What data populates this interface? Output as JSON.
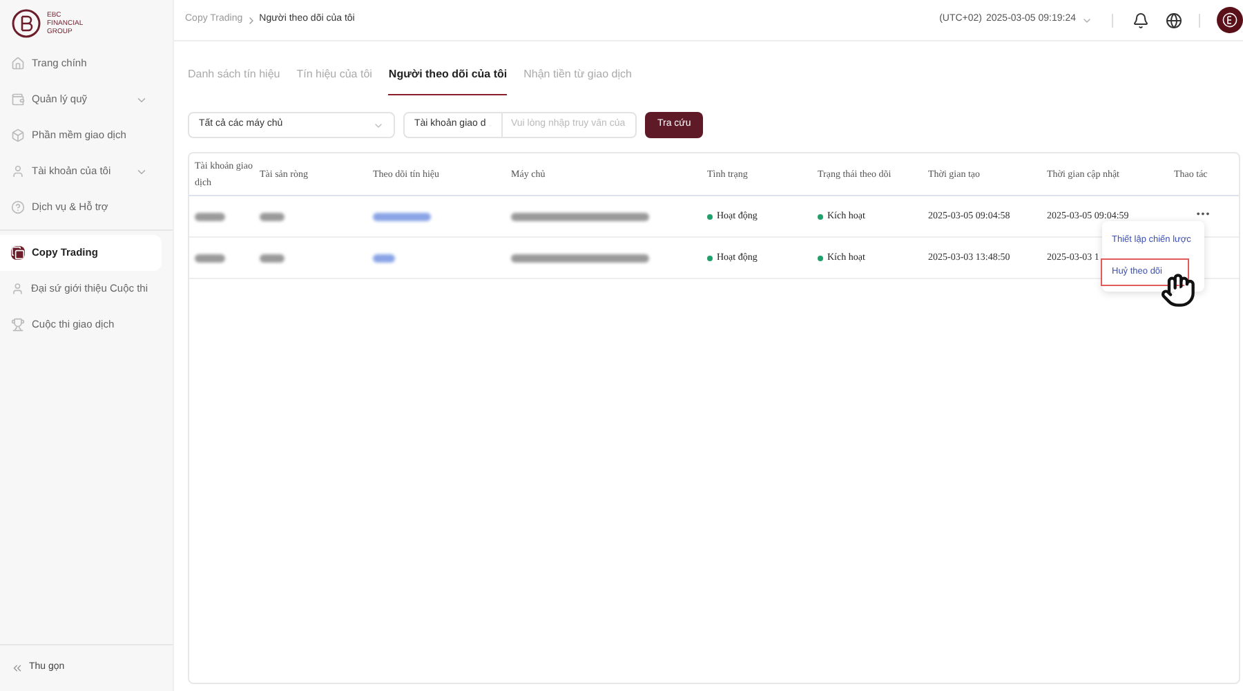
{
  "logo": {
    "lines": [
      "EBC",
      "FINANCIAL",
      "GROUP"
    ]
  },
  "sidebar": {
    "items": [
      {
        "label": "Trang chính",
        "expandable": false,
        "selected": false
      },
      {
        "label": "Quản lý quỹ",
        "expandable": true,
        "selected": false
      },
      {
        "label": "Phần mềm giao dịch",
        "expandable": false,
        "selected": false
      },
      {
        "label": "Tài khoản của tôi",
        "expandable": true,
        "selected": false
      },
      {
        "label": "Dịch vụ & Hỗ trợ",
        "expandable": false,
        "selected": false
      },
      {
        "label": "Copy Trading",
        "expandable": false,
        "selected": true
      },
      {
        "label": "Đại sứ giới thiệu Cuộc thi",
        "expandable": false,
        "selected": false
      },
      {
        "label": "Cuộc thi giao dịch",
        "expandable": false,
        "selected": false
      }
    ],
    "collapse": "Thu gọn"
  },
  "breadcrumb": [
    "Copy Trading",
    "Người theo dõi của tôi"
  ],
  "header": {
    "timezone": "(UTC+02)",
    "datetime": "2025-03-05 09:19:24"
  },
  "tabs": [
    {
      "label": "Danh sách tín hiệu",
      "selected": false
    },
    {
      "label": "Tín hiệu của tôi",
      "selected": false
    },
    {
      "label": "Người theo dõi của tôi",
      "selected": true
    },
    {
      "label": "Nhận tiền từ giao dịch",
      "selected": false
    }
  ],
  "filters": {
    "server": "Tất cả các máy chủ",
    "account_type": "Tài khoản giao d",
    "search_placeholder": "Vui lòng nhập truy vấn của",
    "button": "Tra cứu"
  },
  "table": {
    "columns": [
      "Tài khoản giao dịch",
      "Tài sản ròng",
      "Theo dõi tín hiệu",
      "Máy chủ",
      "Tình trạng",
      "Trạng thái theo dõi",
      "Thời gian tạo",
      "Thời gian cập nhật",
      "Thao tác"
    ],
    "rows": [
      {
        "status": "Hoạt động",
        "follow_state": "Kích hoạt",
        "created": "2025-03-05 09:04:58",
        "updated": "2025-03-05 09:04:59",
        "menu": "•••"
      },
      {
        "status": "Hoạt động",
        "follow_state": "Kích hoạt",
        "created": "2025-03-03 13:48:50",
        "updated": "2025-03-03 1"
      }
    ]
  },
  "action_menu": {
    "items": [
      {
        "label": "Thiết lập chiến lược",
        "highlighted": false
      },
      {
        "label": "Huỷ theo dõi",
        "highlighted": true
      }
    ]
  }
}
